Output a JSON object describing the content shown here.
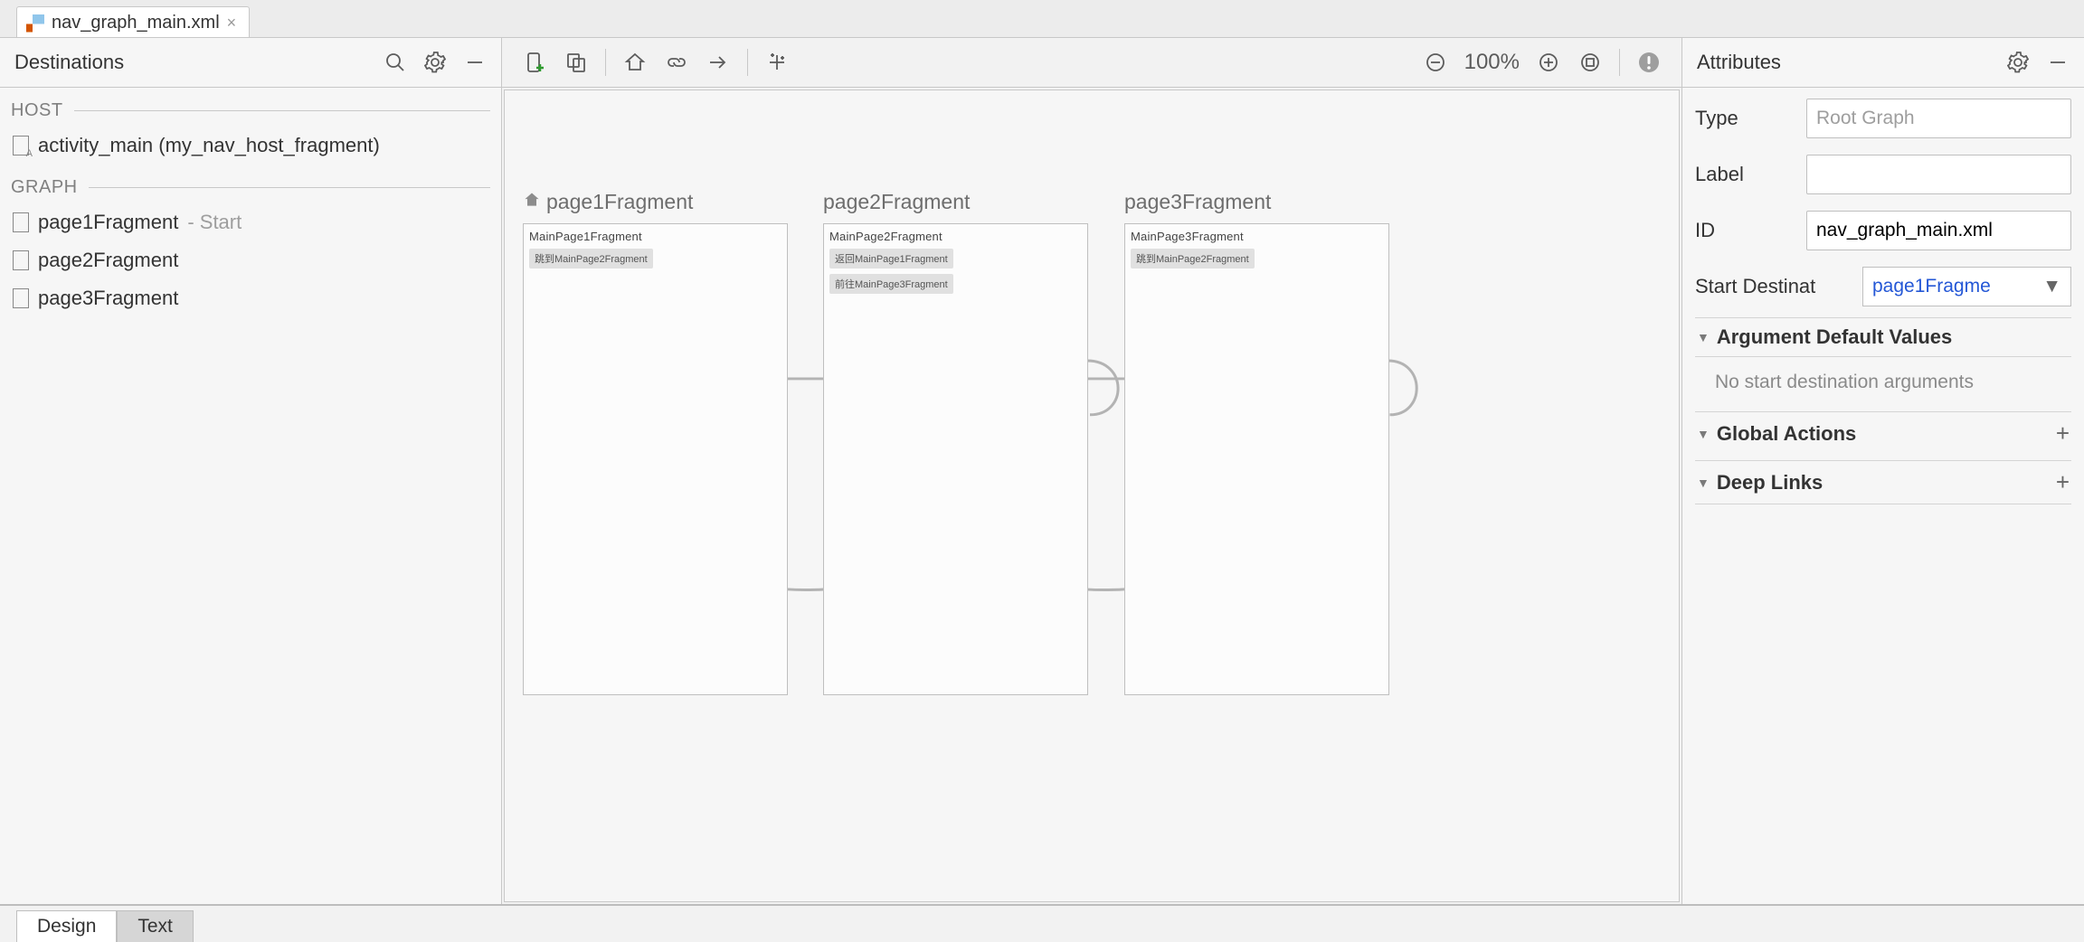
{
  "file_tab": {
    "name": "nav_graph_main.xml"
  },
  "left_panel": {
    "title": "Destinations",
    "host_section": "HOST",
    "host_item": "activity_main (my_nav_host_fragment)",
    "graph_section": "GRAPH",
    "graph_items": [
      {
        "name": "page1Fragment",
        "suffix": " - Start"
      },
      {
        "name": "page2Fragment",
        "suffix": ""
      },
      {
        "name": "page3Fragment",
        "suffix": ""
      }
    ]
  },
  "toolbar": {
    "zoom": "100%"
  },
  "canvas": {
    "nodes": [
      {
        "title": "page1Fragment",
        "is_start": true,
        "preview_title": "MainPage1Fragment",
        "chips": [
          "跳到MainPage2Fragment"
        ]
      },
      {
        "title": "page2Fragment",
        "is_start": false,
        "preview_title": "MainPage2Fragment",
        "chips": [
          "返回MainPage1Fragment",
          "前往MainPage3Fragment"
        ]
      },
      {
        "title": "page3Fragment",
        "is_start": false,
        "preview_title": "MainPage3Fragment",
        "chips": [
          "跳到MainPage2Fragment"
        ]
      }
    ]
  },
  "attributes": {
    "title": "Attributes",
    "type_label": "Type",
    "type_placeholder": "Root Graph",
    "label_label": "Label",
    "label_value": "",
    "id_label": "ID",
    "id_value": "nav_graph_main.xml",
    "start_label": "Start Destinat",
    "start_value": "page1Fragme",
    "arg_defaults_header": "Argument Default Values",
    "arg_hint": "No start destination arguments",
    "global_actions_header": "Global Actions",
    "deep_links_header": "Deep Links"
  },
  "bottom_tabs": {
    "design": "Design",
    "text": "Text"
  }
}
